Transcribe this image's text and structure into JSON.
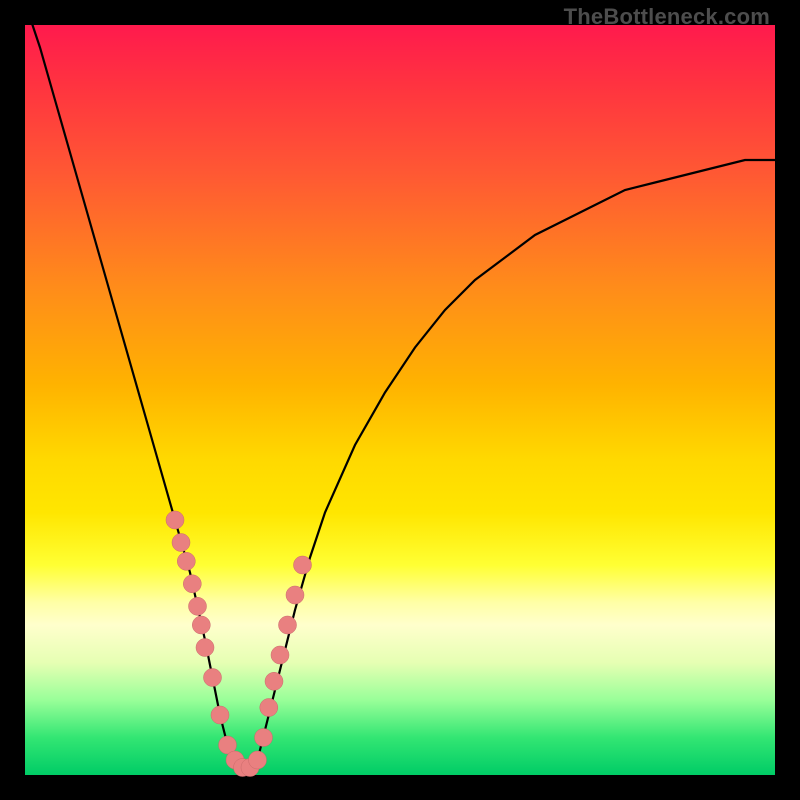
{
  "watermark": "TheBottleneck.com",
  "colors": {
    "curve_stroke": "#000000",
    "marker_fill": "#e98080",
    "marker_stroke": "#c96a6a"
  },
  "chart_data": {
    "type": "line",
    "title": "",
    "xlabel": "",
    "ylabel": "",
    "xlim": [
      0,
      100
    ],
    "ylim": [
      0,
      100
    ],
    "series": [
      {
        "name": "bottleneck-curve",
        "x": [
          0,
          2,
          4,
          6,
          8,
          10,
          12,
          14,
          16,
          18,
          20,
          22,
          24,
          25,
          26,
          27,
          28,
          29,
          30,
          31,
          32,
          34,
          36,
          38,
          40,
          44,
          48,
          52,
          56,
          60,
          64,
          68,
          72,
          76,
          80,
          84,
          88,
          92,
          96,
          100
        ],
        "y": [
          103,
          97,
          90,
          83,
          76,
          69,
          62,
          55,
          48,
          41,
          34,
          27,
          18,
          13,
          8,
          4,
          2,
          1,
          1,
          2,
          6,
          14,
          22,
          29,
          35,
          44,
          51,
          57,
          62,
          66,
          69,
          72,
          74,
          76,
          78,
          79,
          80,
          81,
          82,
          82
        ]
      }
    ],
    "markers": {
      "name": "highlight-dots",
      "x": [
        20.0,
        20.8,
        21.5,
        22.3,
        23.0,
        23.5,
        24.0,
        25.0,
        26.0,
        27.0,
        28.0,
        29.0,
        30.0,
        31.0,
        31.8,
        32.5,
        33.2,
        34.0,
        35.0,
        36.0,
        37.0
      ],
      "y": [
        34.0,
        31.0,
        28.5,
        25.5,
        22.5,
        20.0,
        17.0,
        13.0,
        8.0,
        4.0,
        2.0,
        1.0,
        1.0,
        2.0,
        5.0,
        9.0,
        12.5,
        16.0,
        20.0,
        24.0,
        28.0
      ]
    }
  }
}
